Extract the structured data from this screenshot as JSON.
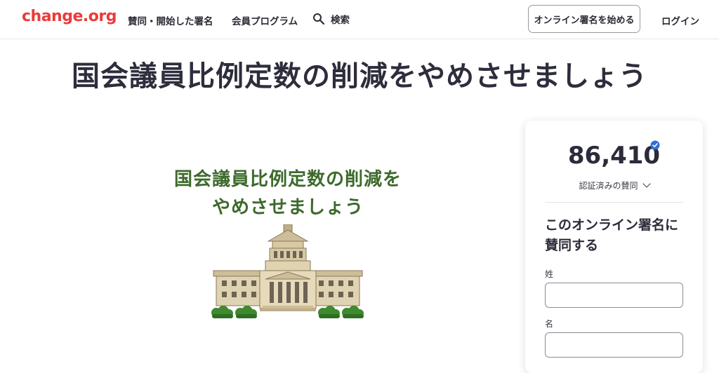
{
  "header": {
    "logo": "change.org",
    "nav_signed": "賛同・開始した署名",
    "nav_membership": "会員プログラム",
    "search_label": "検索",
    "start_petition": "オンライン署名を始める",
    "login": "ログイン"
  },
  "petition": {
    "title": "国会議員比例定数の削減をやめさせましょう",
    "hero_line1": "国会議員比例定数の削減を",
    "hero_line2": "やめさせましょう"
  },
  "sign_card": {
    "count": "86,410",
    "count_label": "認証済みの賛同",
    "heading": "このオンライン署名に賛同する",
    "last_name_label": "姓",
    "first_name_label": "名",
    "last_name_value": "",
    "first_name_value": ""
  },
  "colors": {
    "brand": "#eb3b3b",
    "hero_text": "#3d6a2c",
    "verified": "#2f6fdc"
  }
}
